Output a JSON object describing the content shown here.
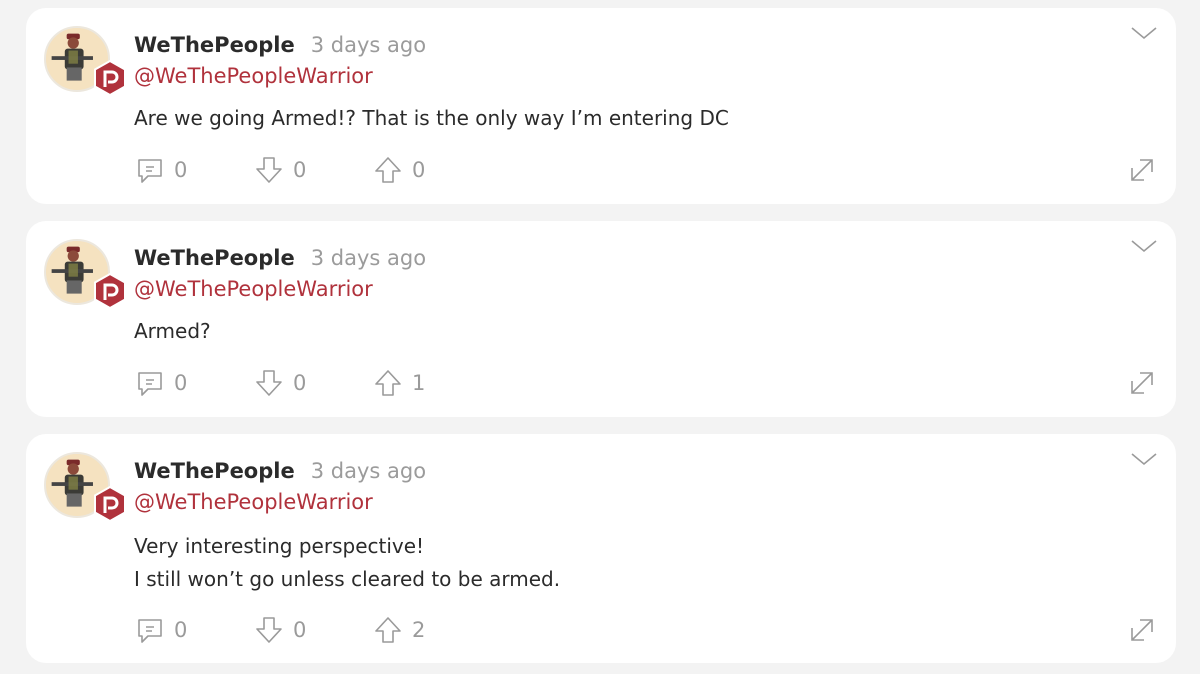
{
  "posts": [
    {
      "author": "WeThePeople",
      "time": "3 days ago",
      "handle": "@WeThePeopleWarrior",
      "lines": [
        "Are we going Armed!? That is the only way I’m entering DC"
      ],
      "comments": "0",
      "downvotes": "0",
      "upvotes": "0"
    },
    {
      "author": "WeThePeople",
      "time": "3 days ago",
      "handle": "@WeThePeopleWarrior",
      "lines": [
        "Armed?"
      ],
      "comments": "0",
      "downvotes": "0",
      "upvotes": "1"
    },
    {
      "author": "WeThePeople",
      "time": "3 days ago",
      "handle": "@WeThePeopleWarrior",
      "lines": [
        "Very interesting perspective!",
        "I still won’t go unless cleared to be armed."
      ],
      "comments": "0",
      "downvotes": "0",
      "upvotes": "2"
    }
  ],
  "colors": {
    "accent": "#b0323c",
    "background": "#f3f3f3",
    "card": "#ffffff"
  },
  "icons": {
    "badge": "parler-badge-icon",
    "comment": "comment-icon",
    "downvote": "downvote-icon",
    "upvote": "upvote-icon",
    "menu": "chevron-down-icon",
    "expand": "expand-icon"
  }
}
